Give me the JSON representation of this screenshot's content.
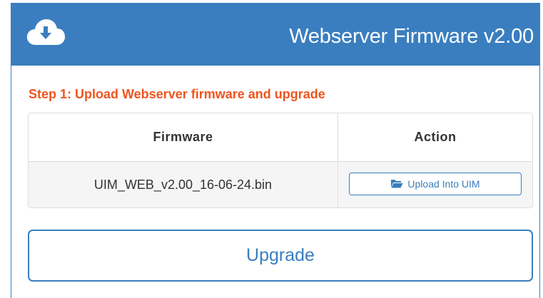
{
  "header": {
    "icon": "cloud-download-icon",
    "title": "Webserver Firmware v2.00"
  },
  "step": {
    "label": "Step 1: Upload Webserver firmware and upgrade"
  },
  "table": {
    "columns": [
      "Firmware",
      "Action"
    ],
    "rows": [
      {
        "firmware": "UIM_WEB_v2.00_16-06-24.bin",
        "action_label": "Upload Into UIM",
        "action_icon": "folder-open-icon"
      }
    ]
  },
  "upgrade": {
    "label": "Upgrade"
  },
  "colors": {
    "accent": "#3a7ebf",
    "step_label": "#f0541e",
    "row_bg": "#f5f5f5"
  }
}
